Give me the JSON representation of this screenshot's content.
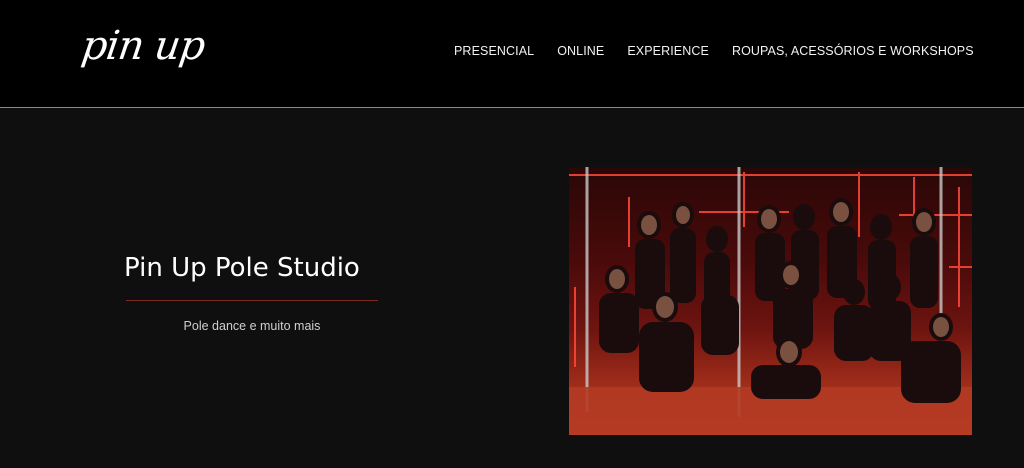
{
  "header": {
    "logo_text": "pin up",
    "nav": [
      {
        "label": "PRESENCIAL"
      },
      {
        "label": "ONLINE"
      },
      {
        "label": "EXPERIENCE"
      },
      {
        "label": "ROUPAS, ACESSÓRIOS E WORKSHOPS"
      }
    ]
  },
  "hero": {
    "title": "Pin Up Pole Studio",
    "subtitle": "Pole dance e muito mais",
    "accent_color": "#7a2a22"
  }
}
